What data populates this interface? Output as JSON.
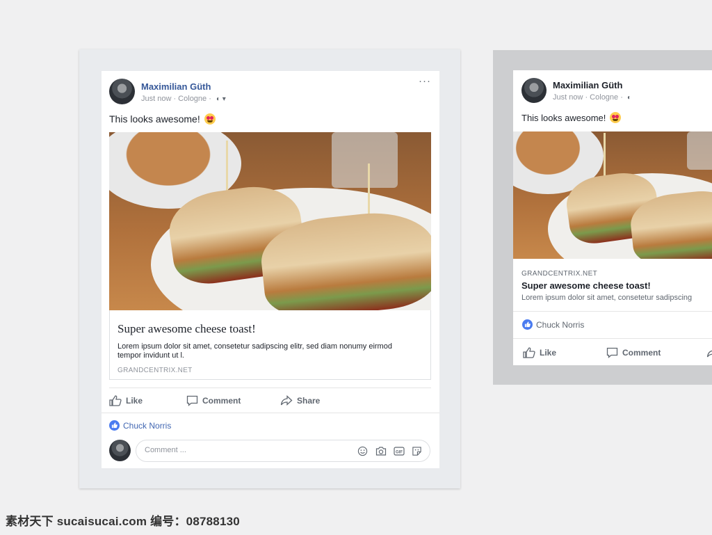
{
  "left_post": {
    "author": "Maximilian Güth",
    "meta": "Just now · Cologne ·",
    "privacy_icon": "globe-icon",
    "more_label": "···",
    "text": "This looks awesome!",
    "link": {
      "title": "Super awesome cheese toast!",
      "description": "Lorem ipsum dolor sit amet, consetetur sadipscing elitr, sed diam nonumy eirmod tempor invidunt ut l.",
      "source": "GRANDCENTRIX.NET"
    },
    "actions": {
      "like": "Like",
      "comment": "Comment",
      "share": "Share"
    },
    "reaction_name": "Chuck Norris",
    "comment_placeholder": "Comment ...",
    "comment_icons": [
      "emoji-icon",
      "camera-icon",
      "gif-icon",
      "sticker-icon"
    ]
  },
  "right_post": {
    "author": "Maximilian Güth",
    "meta": "Just now · Cologne ·",
    "text": "This looks awesome!",
    "link": {
      "source": "GRANDCENTRIX.NET",
      "title": "Super awesome cheese toast!",
      "description": "Lorem ipsum dolor sit amet, consetetur sadipscing"
    },
    "reaction_name": "Chuck Norris",
    "actions": {
      "like": "Like",
      "comment": "Comment"
    }
  },
  "watermark": "素材天下 sucaisucai.com  编号：08788130",
  "colors": {
    "link_blue": "#365899",
    "reaction_blue": "#4a7bf0",
    "muted": "#90949c"
  }
}
